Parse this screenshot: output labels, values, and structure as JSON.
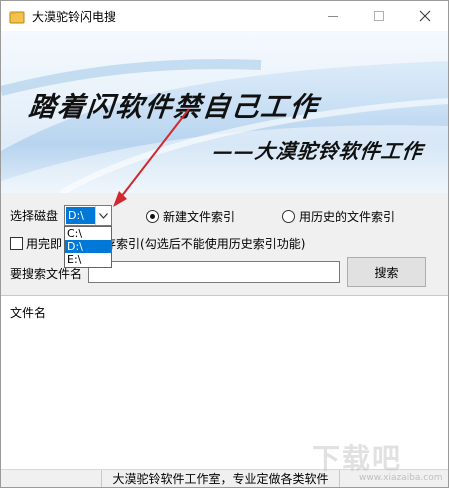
{
  "window": {
    "title": "大漠驼铃闪电搜"
  },
  "banner": {
    "line1": "踏着闪软件禁自己工作",
    "line2": "——大漠驼铃软件工作"
  },
  "controls": {
    "disk_label": "选择磁盘",
    "disk_selected": "D:\\",
    "disk_options": [
      "C:\\",
      "D:\\",
      "E:\\"
    ],
    "radio_new": "新建文件索引",
    "radio_history": "用历史的文件索引",
    "checkbox_label_prefix": "用完即",
    "checkbox_label_suffix": "存索引(勾选后不能使用历史索引功能)",
    "search_label": "要搜索文件名",
    "search_value": "",
    "search_button": "搜索"
  },
  "result": {
    "column_header": "文件名"
  },
  "status": {
    "text": "大漠驼铃软件工作室，专业定做各类软件"
  },
  "watermark": {
    "text": "下载吧",
    "sub": "www.xiazaiba.com"
  },
  "colors": {
    "selection": "#0078d7",
    "arrow": "#d0282d"
  }
}
